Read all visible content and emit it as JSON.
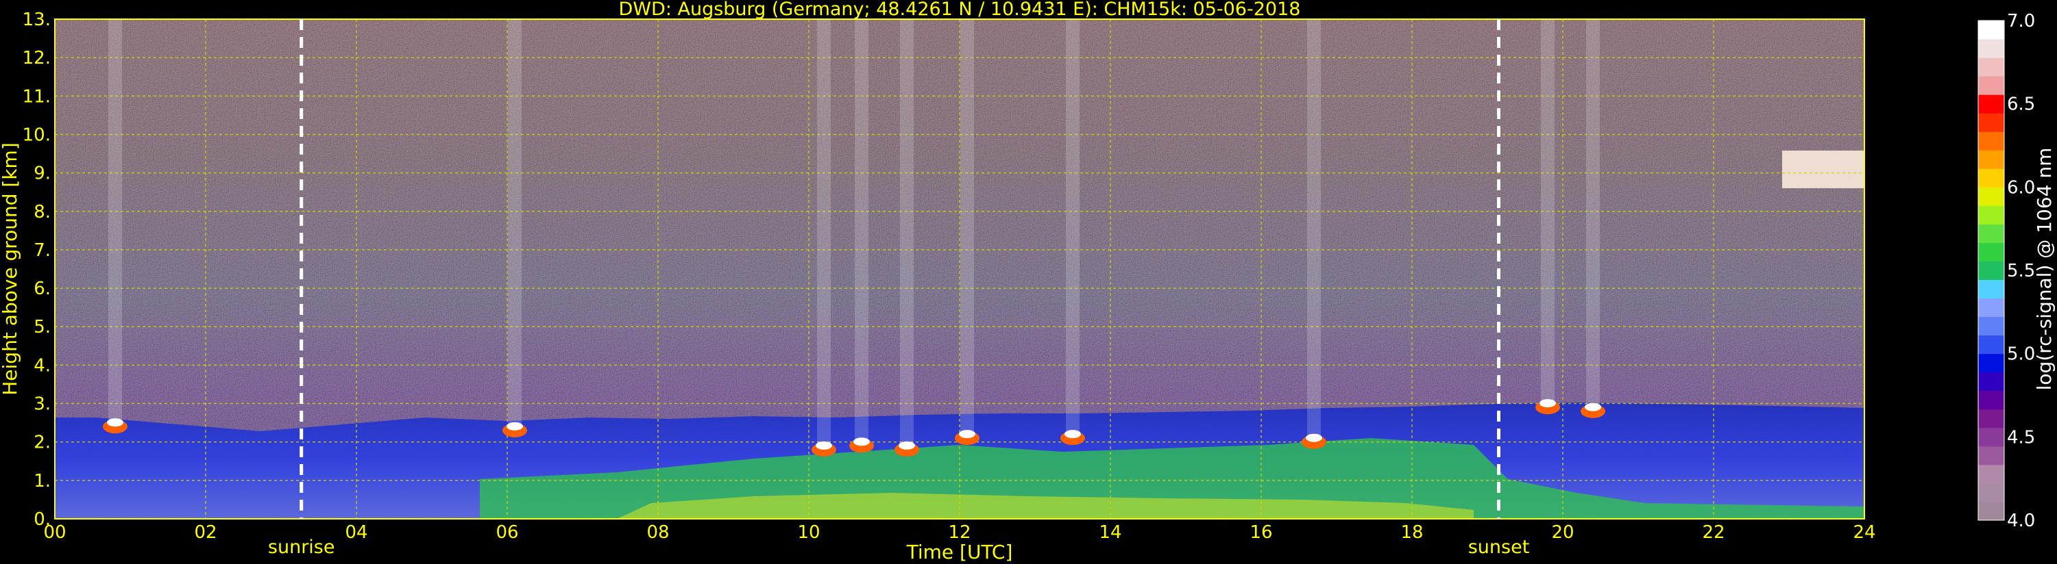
{
  "chart_data": {
    "type": "heatmap",
    "title": "DWD: Augsburg (Germany; 48.4261 N / 10.9431 E):    CHM15k: 05-06-2018",
    "xlabel": "Time [UTC]",
    "ylabel": "Height above ground [km]",
    "xlim": [
      0,
      24
    ],
    "ylim": [
      0,
      13
    ],
    "x_ticks": [
      "00",
      "02",
      "04",
      "06",
      "08",
      "10",
      "12",
      "14",
      "16",
      "18",
      "20",
      "22",
      "24"
    ],
    "y_ticks": [
      "0.",
      "1.",
      "2.",
      "3.",
      "4.",
      "5.",
      "6.",
      "7.",
      "8.",
      "9.",
      "10.",
      "11.",
      "12.",
      "13."
    ],
    "grid": true,
    "colorbar": {
      "label": "log(rc-signal) @ 1064 nm",
      "range": [
        4.0,
        7.0
      ],
      "ticks": [
        "4.0",
        "4.5",
        "5.0",
        "5.5",
        "6.0",
        "6.5",
        "7.0"
      ],
      "colors": [
        "#a08898",
        "#a88ba4",
        "#b08aa8",
        "#9a5a9c",
        "#8a3a98",
        "#7a1a90",
        "#6000a0",
        "#3000c0",
        "#0010e0",
        "#3050f0",
        "#6080f8",
        "#8aa0ff",
        "#50d0ff",
        "#20c060",
        "#30d040",
        "#60e040",
        "#a0f020",
        "#e0f000",
        "#ffd000",
        "#ffa000",
        "#ff7000",
        "#ff3000",
        "#ff0000",
        "#f0a0a0",
        "#f0c0c0",
        "#f0e0e0",
        "#ffffff"
      ]
    },
    "markers": [
      {
        "label": "sunrise",
        "x": 3.27
      },
      {
        "label": "sunset",
        "x": 19.15
      }
    ],
    "features": [
      {
        "name": "residual layer top",
        "x_range": [
          0,
          24
        ],
        "height_km": [
          2.1,
          2.9
        ]
      },
      {
        "name": "cloud bases",
        "x": [
          0.8,
          6.1,
          10.2,
          10.7,
          11.3,
          12.1,
          13.5,
          16.7,
          19.8,
          20.4
        ],
        "height_km": [
          2.4,
          2.3,
          1.8,
          1.9,
          1.8,
          2.1,
          2.1,
          2.0,
          2.9,
          2.8
        ]
      },
      {
        "name": "cirrus",
        "x_range": [
          23.0,
          24.0
        ],
        "height_km": [
          8.7,
          9.4
        ]
      }
    ]
  }
}
